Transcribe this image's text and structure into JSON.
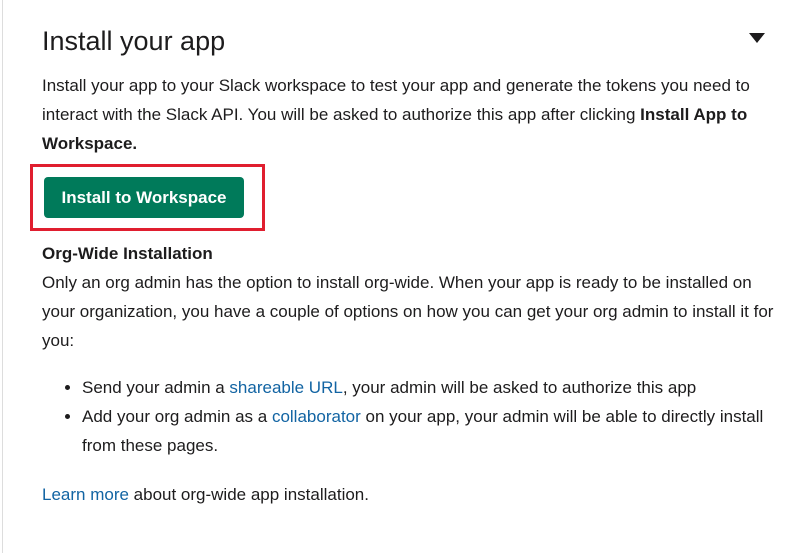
{
  "section": {
    "title": "Install your app",
    "intro_text": "Install your app to your Slack workspace to test your app and generate the tokens you need to interact with the Slack API. You will be asked to authorize this app after clicking ",
    "intro_bold": "Install App to Workspace.",
    "install_button_label": "Install to Workspace"
  },
  "org": {
    "heading": "Org-Wide Installation",
    "description": "Only an org admin has the option to install org-wide. When your app is ready to be installed on your organization, you have a couple of options on how you can get your org admin to install it for you:",
    "bullets": [
      {
        "before": "Send your admin a ",
        "link": "shareable URL",
        "after": ", your admin will be asked to authorize this app"
      },
      {
        "before": "Add your org admin as a ",
        "link": "collaborator",
        "after": " on your app, your admin will be able to directly install from these pages."
      }
    ],
    "footer_link": "Learn more",
    "footer_text": " about org-wide app installation."
  },
  "colors": {
    "button_bg": "#007a5a",
    "link": "#1264a3",
    "highlight": "#e01e2f"
  },
  "icons": {
    "collapse": "caret-down-icon"
  }
}
